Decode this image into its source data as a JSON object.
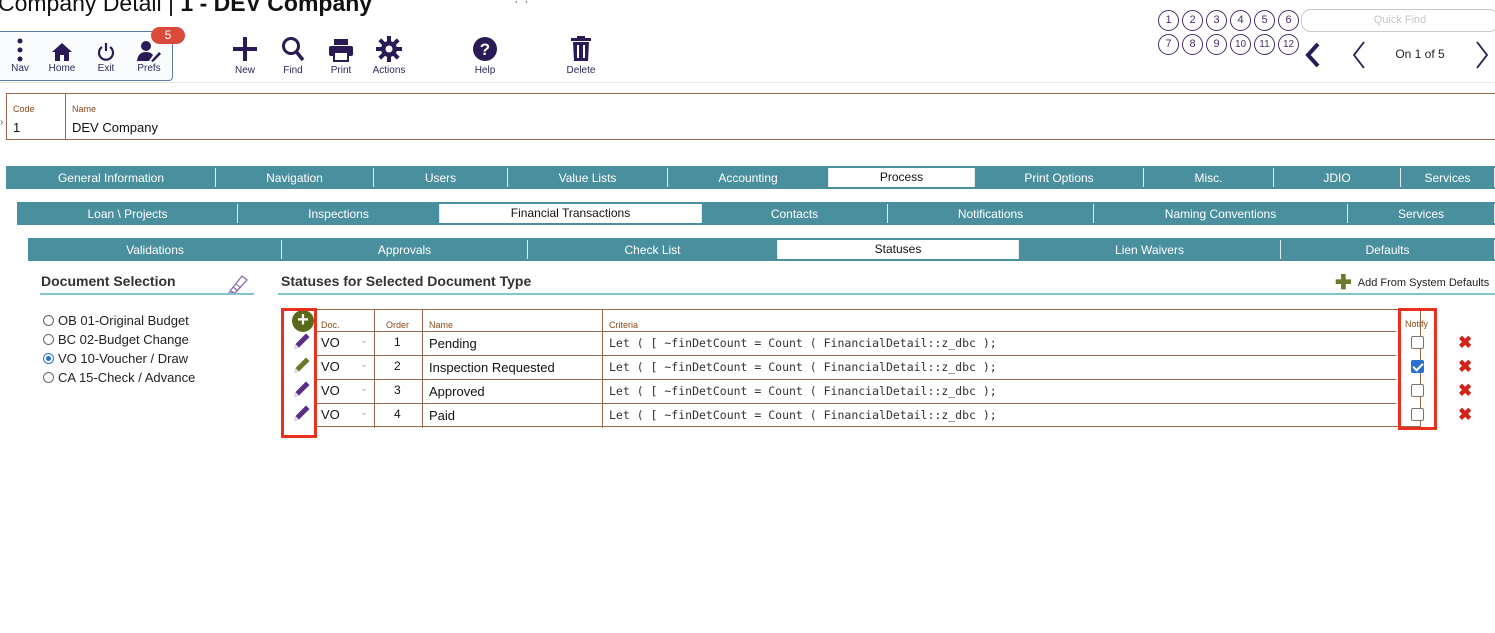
{
  "header": {
    "title_prefix": "Company Detail | ",
    "title_bold": "1 - DEV Company",
    "title_tick": "' , ' , '"
  },
  "toolbar": {
    "nav_label": "Nav",
    "home_label": "Home",
    "exit_label": "Exit",
    "prefs_label": "Prefs",
    "prefs_badge": "5",
    "new_label": "New",
    "find_label": "Find",
    "print_label": "Print",
    "actions_label": "Actions",
    "help_label": "Help",
    "delete_label": "Delete"
  },
  "shortcuts": [
    "1",
    "2",
    "3",
    "4",
    "5",
    "6",
    "7",
    "8",
    "9",
    "10",
    "11",
    "12"
  ],
  "quick_find": {
    "placeholder": "Quick Find"
  },
  "record_nav": {
    "info": "On 1 of 5"
  },
  "record": {
    "code_label": "Code",
    "code_value": "1",
    "name_label": "Name",
    "name_value": "DEV Company"
  },
  "tabs_level1": [
    "General Information",
    "Navigation",
    "Users",
    "Value Lists",
    "Accounting",
    "Process",
    "Print Options",
    "Misc.",
    "JDIO",
    "Services"
  ],
  "tabs_level1_active": "Process",
  "tabs_level2": [
    "Loan \\ Projects",
    "Inspections",
    "Financial Transactions",
    "Contacts",
    "Notifications",
    "Naming Conventions",
    "Services"
  ],
  "tabs_level2_active": "Financial Transactions",
  "tabs_level3": [
    "Validations",
    "Approvals",
    "Check List",
    "Statuses",
    "Lien Waivers",
    "Defaults"
  ],
  "tabs_level3_active": "Statuses",
  "document_selection": {
    "title": "Document Selection",
    "items": [
      {
        "label": "OB 01-Original Budget",
        "selected": false
      },
      {
        "label": "BC 02-Budget Change",
        "selected": false
      },
      {
        "label": "VO 10-Voucher / Draw",
        "selected": true
      },
      {
        "label": "CA 15-Check / Advance",
        "selected": false
      }
    ]
  },
  "statuses": {
    "title": "Statuses for Selected Document Type",
    "add_defaults_label": "Add From System Defaults",
    "columns": {
      "doc": "Doc.",
      "order": "Order",
      "name": "Name",
      "criteria": "Criteria",
      "notify": "Notify"
    },
    "rows": [
      {
        "doc": "VO",
        "order": "1",
        "name": "Pending",
        "criteria": "Let ( [ ~finDetCount = Count ( FinancialDetail::z_dbc );",
        "notify": false
      },
      {
        "doc": "VO",
        "order": "2",
        "name": "Inspection Requested",
        "criteria": "Let ( [ ~finDetCount = Count ( FinancialDetail::z_dbc );",
        "notify": true
      },
      {
        "doc": "VO",
        "order": "3",
        "name": "Approved",
        "criteria": "Let ( [ ~finDetCount = Count ( FinancialDetail::z_dbc );",
        "notify": false
      },
      {
        "doc": "VO",
        "order": "4",
        "name": "Paid",
        "criteria": "Let ( [ ~finDetCount = Count ( FinancialDetail::z_dbc );",
        "notify": false
      }
    ]
  },
  "colors": {
    "tab_bg": "#4a8f9e",
    "accent_purple": "#4a2d6b",
    "highlight_red": "#e8301c",
    "delete_red": "#d0231a"
  }
}
